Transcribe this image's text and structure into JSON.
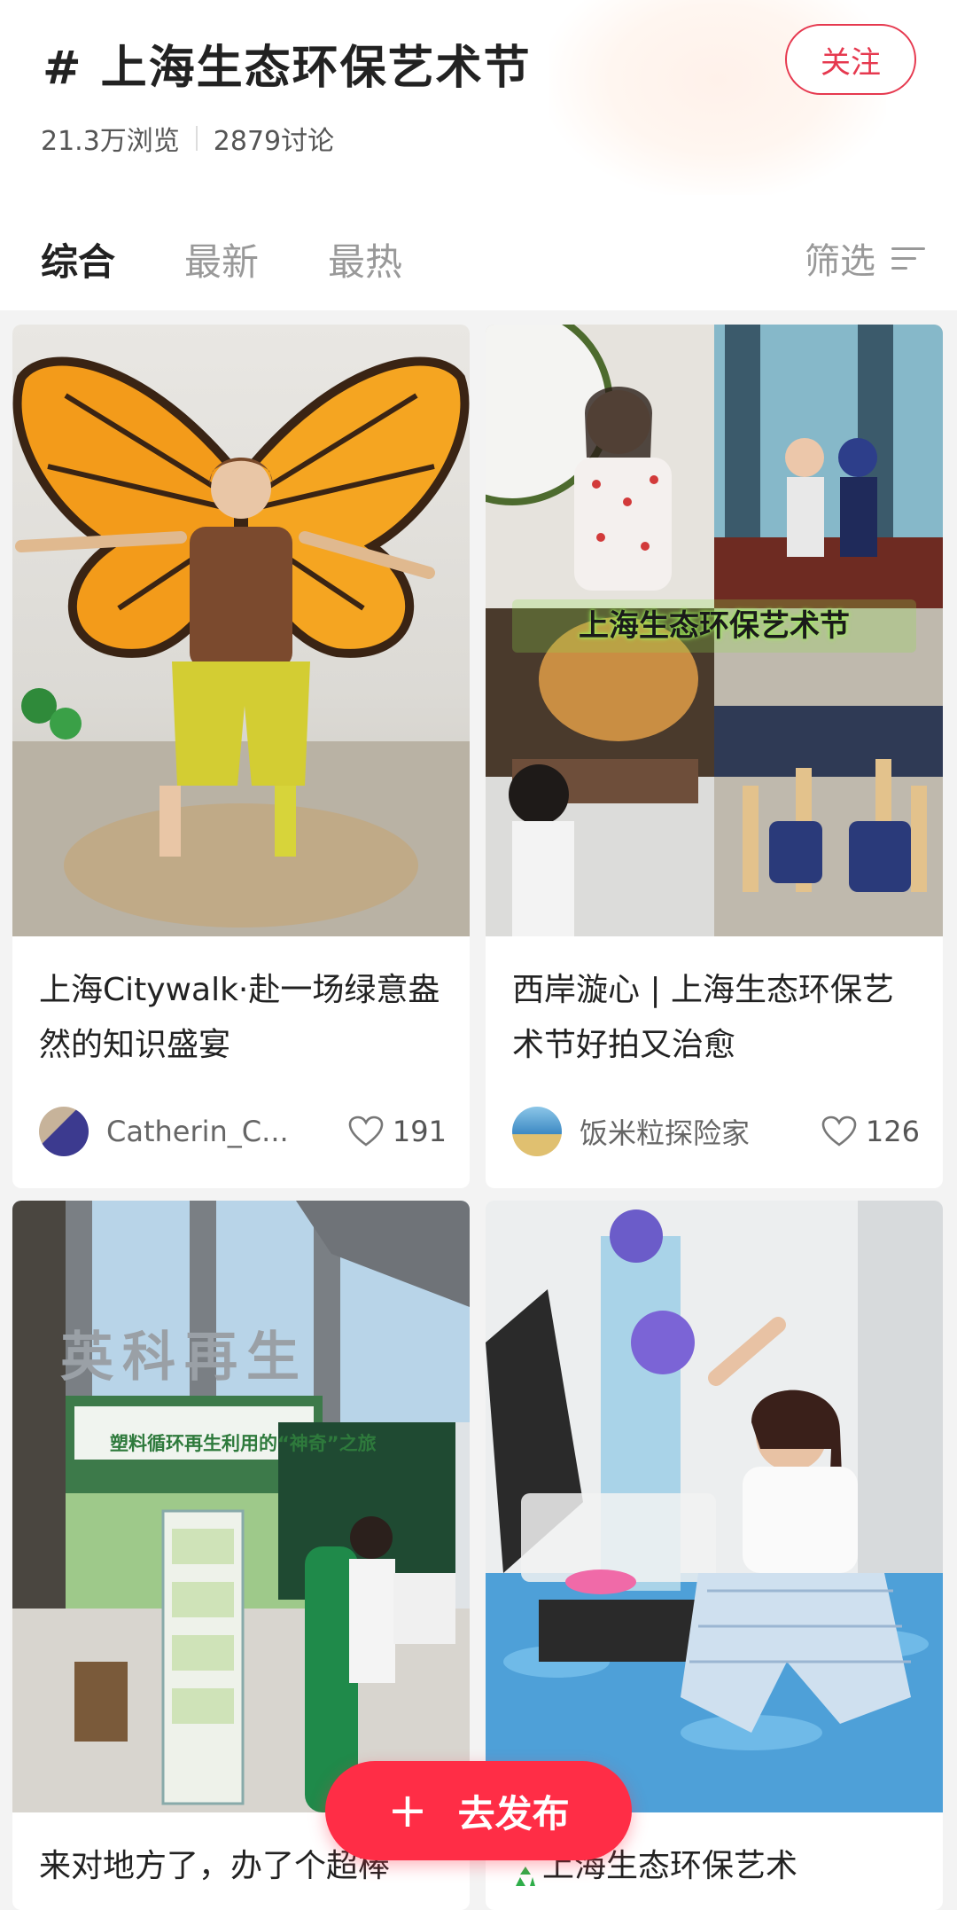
{
  "header": {
    "topic_title": "# 上海生态环保艺术节",
    "follow_label": "关注",
    "views": "21.3万浏览",
    "discussions": "2879讨论"
  },
  "tabs": [
    {
      "label": "综合",
      "active": true
    },
    {
      "label": "最新",
      "active": false
    },
    {
      "label": "最热",
      "active": false
    }
  ],
  "filter_label": "筛选",
  "posts": [
    {
      "title": "上海Citywalk·赴一场绿意盎然的知识盛宴",
      "author": "Catherin_C...",
      "likes": "191"
    },
    {
      "title": "西岸漩心 | 上海生态环保艺术节好拍又治愈",
      "author": "饭米粒探险家",
      "likes": "126",
      "image_banner": "上海生态环保艺术节"
    },
    {
      "title": "来对地方了，办了个超棒",
      "image_sign": "英科再生",
      "booth_title": "塑料循环再生利用的“神奇”之旅"
    },
    {
      "title": "上海生态环保艺术"
    }
  ],
  "publish_label": "去发布",
  "colors": {
    "accent": "#ff2d46",
    "follow": "#e6394f"
  }
}
